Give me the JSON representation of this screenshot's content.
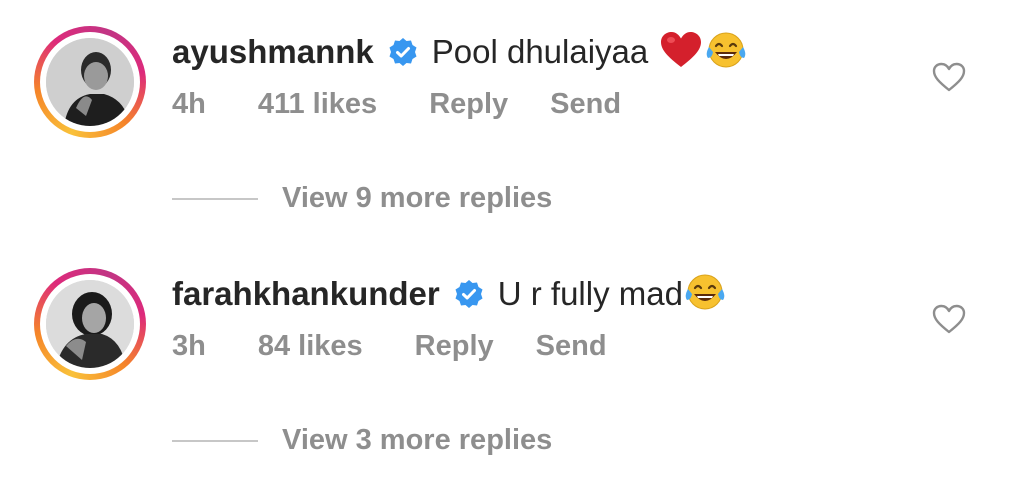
{
  "comments": [
    {
      "username": "ayushmannk",
      "text": "Pool dhulaiyaa",
      "time": "4h",
      "likes": "411 likes",
      "reply_label": "Reply",
      "send_label": "Send",
      "view_replies": "View 9 more replies",
      "emojis": [
        "red-heart",
        "tears-of-joy"
      ]
    },
    {
      "username": "farahkhankunder",
      "text": "U r fully mad",
      "time": "3h",
      "likes": "84 likes",
      "reply_label": "Reply",
      "send_label": "Send",
      "view_replies": "View 3 more replies",
      "emojis": [
        "tears-of-joy"
      ]
    }
  ],
  "colors": {
    "verified": "#3897f0",
    "meta_text": "#8e8e8e",
    "primary_text": "#262626",
    "story_ring": [
      "#f9c13a",
      "#f58529",
      "#dd2a7b",
      "#c13584"
    ]
  },
  "icons": [
    "verified-badge-icon",
    "like-heart-icon",
    "red-heart-emoji",
    "tears-of-joy-emoji"
  ]
}
